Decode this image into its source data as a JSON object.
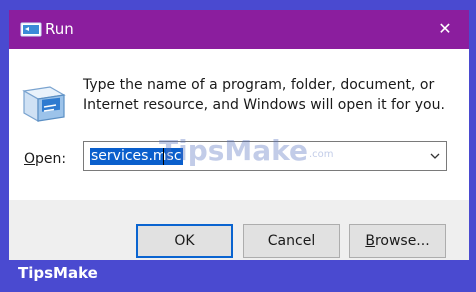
{
  "window": {
    "title": "Run",
    "close_glyph": "✕"
  },
  "description": "Type the name of a program, folder, document, or Internet resource, and Windows will open it for you.",
  "open": {
    "label": "Open:",
    "value": "services.msc"
  },
  "buttons": {
    "ok": "OK",
    "cancel": "Cancel",
    "browse_first": "B",
    "browse_rest": "rowse..."
  },
  "watermark": {
    "text": "TipsMake",
    "suffix": ".com"
  },
  "footer_brand": "TipsMake",
  "colors": {
    "titlebar": "#8b1e9e",
    "frame": "#4a4ad0",
    "selection": "#0a5fcc"
  },
  "icons": [
    "run-app-icon",
    "close-icon",
    "run-icon",
    "chevron-down-icon"
  ]
}
